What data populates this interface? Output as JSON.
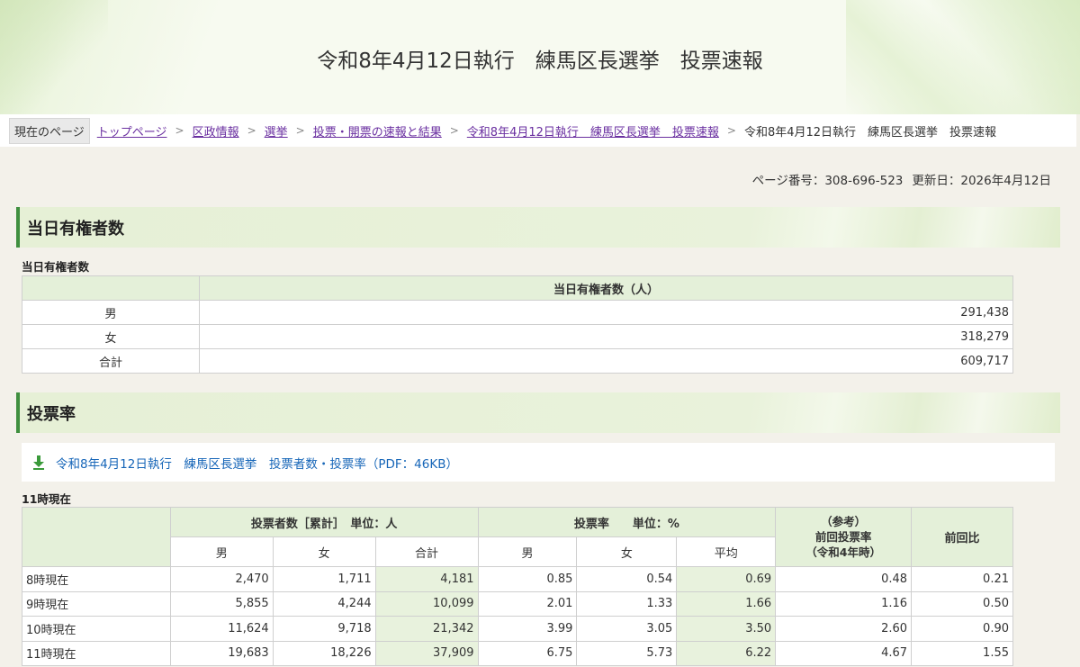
{
  "header": {
    "title": "令和8年4月12日執行　練馬区長選挙　投票速報"
  },
  "breadcrumb": {
    "current_label": "現在のページ",
    "links": [
      "トップページ",
      "区政情報",
      "選挙",
      "投票・開票の速報と結果",
      "令和8年4月12日執行　練馬区長選挙　投票速報"
    ],
    "current": "令和8年4月12日執行　練馬区長選挙　投票速報"
  },
  "meta": {
    "page_number": "ページ番号：308-696-523",
    "updated": "更新日：2026年4月12日"
  },
  "section1": {
    "heading": "当日有権者数",
    "caption": "当日有権者数",
    "header": "当日有権者数（人）",
    "rows": [
      {
        "label": "男",
        "value": "291,438"
      },
      {
        "label": "女",
        "value": "318,279"
      },
      {
        "label": "合計",
        "value": "609,717"
      }
    ]
  },
  "section2": {
    "heading": "投票率",
    "pdf_link": "令和8年4月12日執行　練馬区長選挙　投票者数・投票率（PDF：46KB）",
    "caption": "11時現在",
    "group_voters": "投票者数［累計］　単位：人",
    "group_rate": "投票率　　単位：%",
    "prev_rate": [
      "（参考）",
      "前回投票率",
      "（令和4年時）"
    ],
    "prev_ratio": "前回比",
    "sub": [
      "男",
      "女",
      "合計",
      "男",
      "女",
      "平均"
    ],
    "rows": [
      {
        "time": "8時現在",
        "cells": [
          "2,470",
          "1,711",
          "4,181",
          "0.85",
          "0.54",
          "0.69",
          "0.48",
          "0.21"
        ]
      },
      {
        "time": "9時現在",
        "cells": [
          "5,855",
          "4,244",
          "10,099",
          "2.01",
          "1.33",
          "1.66",
          "1.16",
          "0.50"
        ]
      },
      {
        "time": "10時現在",
        "cells": [
          "11,624",
          "9,718",
          "21,342",
          "3.99",
          "3.05",
          "3.50",
          "2.60",
          "0.90"
        ]
      },
      {
        "time": "11時現在",
        "cells": [
          "19,683",
          "18,226",
          "37,909",
          "6.75",
          "5.73",
          "6.22",
          "4.67",
          "1.55"
        ]
      }
    ]
  },
  "icons": {
    "download": "download-icon",
    "breadcrumb_separator": "chevron-right-icon"
  },
  "colors": {
    "accent_green": "#3f8f3f",
    "link_blue": "#1766b8",
    "link_visited": "#6a2fa0",
    "table_header": "#e4f0d9"
  }
}
